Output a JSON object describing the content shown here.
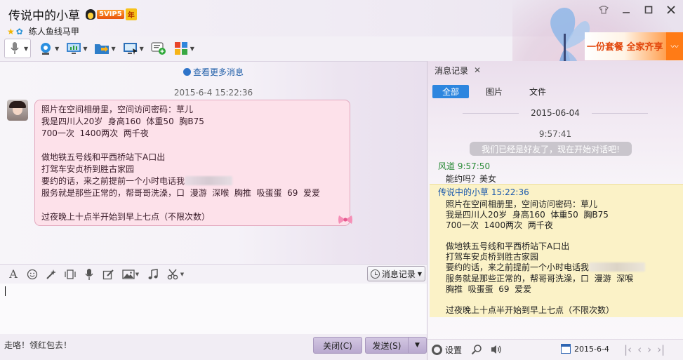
{
  "window": {
    "title": "传说中的小草",
    "vip_label": "5VIP5",
    "vip_year": "年",
    "signature": "练人鱼线马甲"
  },
  "toolbar": {
    "items": [
      "microphone-icon",
      "video-icon",
      "screen-share-icon",
      "file-transfer-icon",
      "remote-desktop-icon",
      "add-apps-icon",
      "app-center-icon"
    ]
  },
  "chat": {
    "more_messages": "查看更多消息",
    "timestamp": "2015-6-4 15:22:36",
    "message_lines": [
      "照片在空间相册里，空间访问密码：草儿",
      "我是四川人20岁  身高160  体重50  胸B75",
      "700一次  1400两次  两千夜",
      "",
      "做地铁五号线和平西桥站下A口出",
      "打驾车安贞桥到胜古家园",
      "要约的话，来之前提前一个小时电话我",
      "服务就是那些正常的，帮哥哥洗澡，口  漫游  深喉  胸推  吸蛋蛋  69  爱爱",
      "",
      "过夜晚上十点半开始到早上七点（不限次数）"
    ]
  },
  "input": {
    "message_record_label": "消息记录",
    "hint": "走咯！领红包去！",
    "close_label": "关闭(C)",
    "send_label": "发送(S)"
  },
  "history": {
    "tab_label": "消息记录",
    "filters": [
      "全部",
      "图片",
      "文件"
    ],
    "date": "2015-06-04",
    "time": "9:57:41",
    "system_msg": "我们已经是好友了，现在开始对话吧!",
    "sender1": "风道  9:57:50",
    "msg1": "能约吗？美女",
    "sender2": "传说中的小草  15:22:36",
    "msg2_lines": [
      "照片在空间相册里，空间访问密码：草儿",
      "我是四川人20岁  身高160  体重50  胸B75",
      "700一次  1400两次  两千夜",
      "",
      "做地铁五号线和平西桥站下A口出",
      "打驾车安贞桥到胜古家园",
      "要约的话，来之前提前一个小时电话我",
      "服务就是那些正常的，帮哥哥洗澡，口  漫游  深喉",
      "胸推  吸蛋蛋  69  爱爱",
      "",
      "过夜晚上十点半开始到早上七点（不限次数）"
    ],
    "settings_label": "设置",
    "date_picker": "2015-6-4"
  },
  "ad": {
    "text": "一份套餐 全家齐享"
  },
  "colors": {
    "accent_blue": "#2d86df",
    "bubble_pink": "#fde1ea",
    "highlight_yellow": "#fbf2c7",
    "sender_green": "#2a8a37"
  }
}
